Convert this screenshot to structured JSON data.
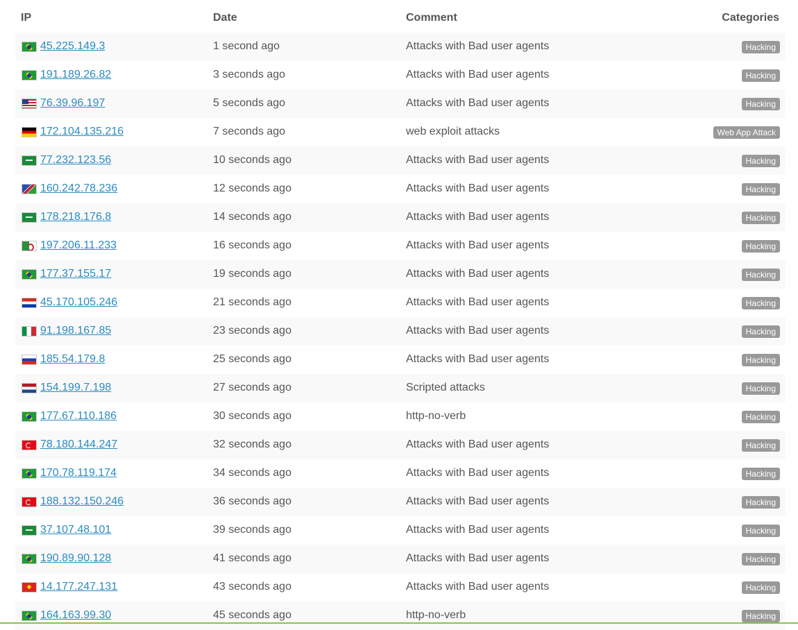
{
  "header": {
    "ip": "IP",
    "date": "Date",
    "comment": "Comment",
    "categories": "Categories"
  },
  "rows": [
    {
      "flag": "brazil-flag-icon",
      "country": "br",
      "ip": "45.225.149.3",
      "date": "1 second ago",
      "comment": "Attacks with Bad user agents",
      "category": "Hacking"
    },
    {
      "flag": "brazil-flag-icon",
      "country": "br",
      "ip": "191.189.26.82",
      "date": "3 seconds ago",
      "comment": "Attacks with Bad user agents",
      "category": "Hacking"
    },
    {
      "flag": "usa-flag-icon",
      "country": "us",
      "ip": "76.39.96.197",
      "date": "5 seconds ago",
      "comment": "Attacks with Bad user agents",
      "category": "Hacking"
    },
    {
      "flag": "germany-flag-icon",
      "country": "de",
      "ip": "172.104.135.216",
      "date": "7 seconds ago",
      "comment": "web exploit attacks",
      "category": "Web App Attack"
    },
    {
      "flag": "saudi-arabia-flag-icon",
      "country": "sa",
      "ip": "77.232.123.56",
      "date": "10 seconds ago",
      "comment": "Attacks with Bad user agents",
      "category": "Hacking"
    },
    {
      "flag": "namibia-flag-icon",
      "country": "na",
      "ip": "160.242.78.236",
      "date": "12 seconds ago",
      "comment": "Attacks with Bad user agents",
      "category": "Hacking"
    },
    {
      "flag": "saudi-arabia-flag-icon",
      "country": "sa",
      "ip": "178.218.176.8",
      "date": "14 seconds ago",
      "comment": "Attacks with Bad user agents",
      "category": "Hacking"
    },
    {
      "flag": "algeria-flag-icon",
      "country": "dz",
      "ip": "197.206.11.233",
      "date": "16 seconds ago",
      "comment": "Attacks with Bad user agents",
      "category": "Hacking"
    },
    {
      "flag": "brazil-flag-icon",
      "country": "br",
      "ip": "177.37.155.17",
      "date": "19 seconds ago",
      "comment": "Attacks with Bad user agents",
      "category": "Hacking"
    },
    {
      "flag": "paraguay-flag-icon",
      "country": "py",
      "ip": "45.170.105.246",
      "date": "21 seconds ago",
      "comment": "Attacks with Bad user agents",
      "category": "Hacking"
    },
    {
      "flag": "italy-flag-icon",
      "country": "it",
      "ip": "91.198.167.85",
      "date": "23 seconds ago",
      "comment": "Attacks with Bad user agents",
      "category": "Hacking"
    },
    {
      "flag": "russia-flag-icon",
      "country": "ru",
      "ip": "185.54.179.8",
      "date": "25 seconds ago",
      "comment": "Attacks with Bad user agents",
      "category": "Hacking"
    },
    {
      "flag": "netherlands-flag-icon",
      "country": "nl",
      "ip": "154.199.7.198",
      "date": "27 seconds ago",
      "comment": "Scripted attacks",
      "category": "Hacking"
    },
    {
      "flag": "brazil-flag-icon",
      "country": "br",
      "ip": "177.67.110.186",
      "date": "30 seconds ago",
      "comment": "http-no-verb",
      "category": "Hacking"
    },
    {
      "flag": "turkey-flag-icon",
      "country": "tr",
      "ip": "78.180.144.247",
      "date": "32 seconds ago",
      "comment": "Attacks with Bad user agents",
      "category": "Hacking"
    },
    {
      "flag": "brazil-flag-icon",
      "country": "br",
      "ip": "170.78.119.174",
      "date": "34 seconds ago",
      "comment": "Attacks with Bad user agents",
      "category": "Hacking"
    },
    {
      "flag": "turkey-flag-icon",
      "country": "tr",
      "ip": "188.132.150.246",
      "date": "36 seconds ago",
      "comment": "Attacks with Bad user agents",
      "category": "Hacking"
    },
    {
      "flag": "saudi-arabia-flag-icon",
      "country": "sa",
      "ip": "37.107.48.101",
      "date": "39 seconds ago",
      "comment": "Attacks with Bad user agents",
      "category": "Hacking"
    },
    {
      "flag": "brazil-flag-icon",
      "country": "br",
      "ip": "190.89.90.128",
      "date": "41 seconds ago",
      "comment": "Attacks with Bad user agents",
      "category": "Hacking"
    },
    {
      "flag": "vietnam-flag-icon",
      "country": "vn",
      "ip": "14.177.247.131",
      "date": "43 seconds ago",
      "comment": "Attacks with Bad user agents",
      "category": "Hacking"
    },
    {
      "flag": "brazil-flag-icon",
      "country": "br",
      "ip": "164.163.99.30",
      "date": "45 seconds ago",
      "comment": "http-no-verb",
      "category": "Hacking"
    }
  ]
}
